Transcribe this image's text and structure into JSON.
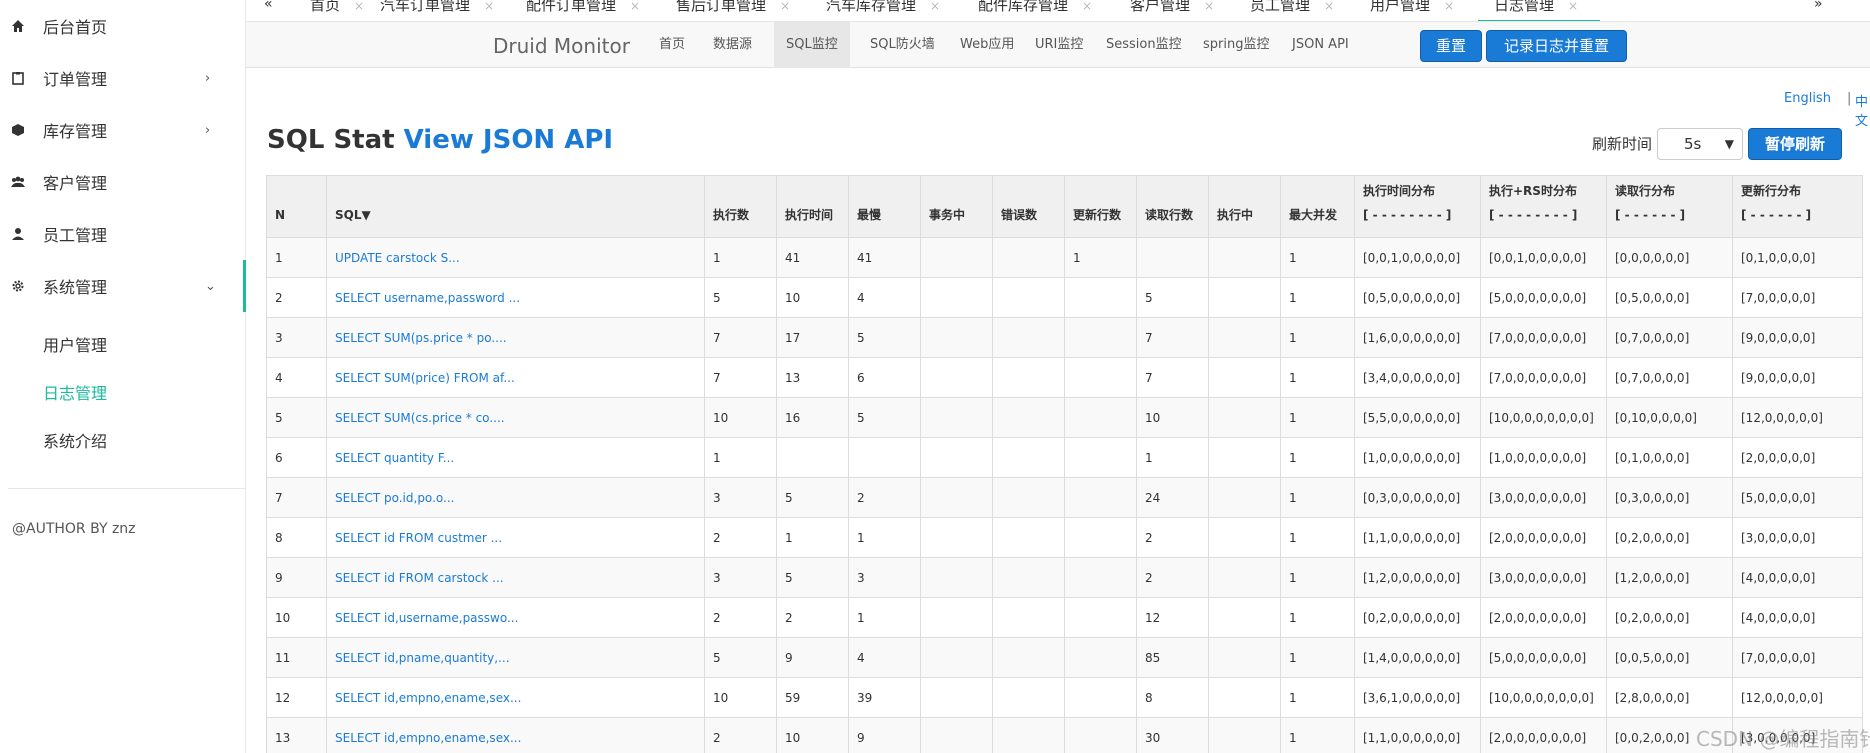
{
  "sidebar": {
    "items": [
      {
        "label": "后台首页",
        "icon": "home-icon",
        "arrow": ""
      },
      {
        "label": "订单管理",
        "icon": "clipboard-icon",
        "arrow": "›"
      },
      {
        "label": "库存管理",
        "icon": "cube-icon",
        "arrow": "›"
      },
      {
        "label": "客户管理",
        "icon": "users-icon",
        "arrow": ""
      },
      {
        "label": "员工管理",
        "icon": "user-icon",
        "arrow": ""
      },
      {
        "label": "系统管理",
        "icon": "gear-icon",
        "arrow": "⌄"
      }
    ],
    "sub_items": [
      "用户管理",
      "日志管理",
      "系统介绍"
    ],
    "author": "@AUTHOR BY znz"
  },
  "tabs": {
    "left_nav": "«",
    "right_nav": "»",
    "items": [
      {
        "label": "首页"
      },
      {
        "label": "汽车订单管理"
      },
      {
        "label": "配件订单管理"
      },
      {
        "label": "售后订单管理"
      },
      {
        "label": "汽车库存管理"
      },
      {
        "label": "配件库存管理"
      },
      {
        "label": "客户管理"
      },
      {
        "label": "员工管理"
      },
      {
        "label": "用户管理"
      },
      {
        "label": "日志管理"
      }
    ],
    "close": "×"
  },
  "druid": {
    "brand": "Druid Monitor",
    "links": [
      "首页",
      "数据源",
      "SQL监控",
      "SQL防火墙",
      "Web应用",
      "URI监控",
      "Session监控",
      "spring监控",
      "JSON API"
    ],
    "reset": "重置",
    "log_reset": "记录日志并重置"
  },
  "lang": {
    "en": "English",
    "sep": "|",
    "zh": "中文"
  },
  "title": {
    "main": "SQL Stat",
    "api": "View JSON API"
  },
  "refresh": {
    "label": "刷新时间",
    "value": "5s",
    "pause": "暂停刷新"
  },
  "table": {
    "headers": [
      "N",
      "SQL▼",
      "执行数",
      "执行时间",
      "最慢",
      "事务中",
      "错误数",
      "更新行数",
      "读取行数",
      "执行中",
      "最大并发",
      "执行时间分布\n[ - - - - - - - - ]",
      "执行+RS时分布\n[ - - - - - - - - ]",
      "读取行分布\n[ - - - - - - ]",
      "更新行分布\n[ - - - - - - ]"
    ],
    "rows": [
      [
        "1",
        "UPDATE carstock S...",
        "1",
        "41",
        "41",
        "",
        "",
        "1",
        "",
        "",
        "1",
        "[0,0,1,0,0,0,0,0]",
        "[0,0,1,0,0,0,0,0]",
        "[0,0,0,0,0,0]",
        "[0,1,0,0,0,0]"
      ],
      [
        "2",
        "SELECT username,password ...",
        "5",
        "10",
        "4",
        "",
        "",
        "",
        "5",
        "",
        "1",
        "[0,5,0,0,0,0,0,0]",
        "[5,0,0,0,0,0,0,0]",
        "[0,5,0,0,0,0]",
        "[7,0,0,0,0,0]"
      ],
      [
        "3",
        "SELECT SUM(ps.price * po....",
        "7",
        "17",
        "5",
        "",
        "",
        "",
        "7",
        "",
        "1",
        "[1,6,0,0,0,0,0,0]",
        "[7,0,0,0,0,0,0,0]",
        "[0,7,0,0,0,0]",
        "[9,0,0,0,0,0]"
      ],
      [
        "4",
        "SELECT SUM(price) FROM af...",
        "7",
        "13",
        "6",
        "",
        "",
        "",
        "7",
        "",
        "1",
        "[3,4,0,0,0,0,0,0]",
        "[7,0,0,0,0,0,0,0]",
        "[0,7,0,0,0,0]",
        "[9,0,0,0,0,0]"
      ],
      [
        "5",
        "SELECT SUM(cs.price * co....",
        "10",
        "16",
        "5",
        "",
        "",
        "",
        "10",
        "",
        "1",
        "[5,5,0,0,0,0,0,0]",
        "[10,0,0,0,0,0,0,0]",
        "[0,10,0,0,0,0]",
        "[12,0,0,0,0,0]"
      ],
      [
        "6",
        "SELECT quantity F...",
        "1",
        "",
        "",
        "",
        "",
        "",
        "1",
        "",
        "1",
        "[1,0,0,0,0,0,0,0]",
        "[1,0,0,0,0,0,0,0]",
        "[0,1,0,0,0,0]",
        "[2,0,0,0,0,0]"
      ],
      [
        "7",
        "SELECT po.id,po.o...",
        "3",
        "5",
        "2",
        "",
        "",
        "",
        "24",
        "",
        "1",
        "[0,3,0,0,0,0,0,0]",
        "[3,0,0,0,0,0,0,0]",
        "[0,3,0,0,0,0]",
        "[5,0,0,0,0,0]"
      ],
      [
        "8",
        "SELECT id FROM custmer ...",
        "2",
        "1",
        "1",
        "",
        "",
        "",
        "2",
        "",
        "1",
        "[1,1,0,0,0,0,0,0]",
        "[2,0,0,0,0,0,0,0]",
        "[0,2,0,0,0,0]",
        "[3,0,0,0,0,0]"
      ],
      [
        "9",
        "SELECT id FROM carstock ...",
        "3",
        "5",
        "3",
        "",
        "",
        "",
        "2",
        "",
        "1",
        "[1,2,0,0,0,0,0,0]",
        "[3,0,0,0,0,0,0,0]",
        "[1,2,0,0,0,0]",
        "[4,0,0,0,0,0]"
      ],
      [
        "10",
        "SELECT id,username,passwo...",
        "2",
        "2",
        "1",
        "",
        "",
        "",
        "12",
        "",
        "1",
        "[0,2,0,0,0,0,0,0]",
        "[2,0,0,0,0,0,0,0]",
        "[0,2,0,0,0,0]",
        "[4,0,0,0,0,0]"
      ],
      [
        "11",
        "SELECT id,pname,quantity,...",
        "5",
        "9",
        "4",
        "",
        "",
        "",
        "85",
        "",
        "1",
        "[1,4,0,0,0,0,0,0]",
        "[5,0,0,0,0,0,0,0]",
        "[0,0,5,0,0,0]",
        "[7,0,0,0,0,0]"
      ],
      [
        "12",
        "SELECT id,empno,ename,sex...",
        "10",
        "59",
        "39",
        "",
        "",
        "",
        "8",
        "",
        "1",
        "[3,6,1,0,0,0,0,0]",
        "[10,0,0,0,0,0,0,0]",
        "[2,8,0,0,0,0]",
        "[12,0,0,0,0,0]"
      ],
      [
        "13",
        "SELECT id,empno,ename,sex...",
        "2",
        "10",
        "9",
        "",
        "",
        "",
        "30",
        "",
        "1",
        "[1,1,0,0,0,0,0,0]",
        "[2,0,0,0,0,0,0,0]",
        "[0,0,2,0,0,0]",
        "[3,0,0,0,0,0]"
      ]
    ]
  },
  "watermark": "CSDN @编程指南针",
  "colors": {
    "accent": "#1abc9c",
    "link": "#1a7bd6",
    "button": "#1a7bd6"
  }
}
